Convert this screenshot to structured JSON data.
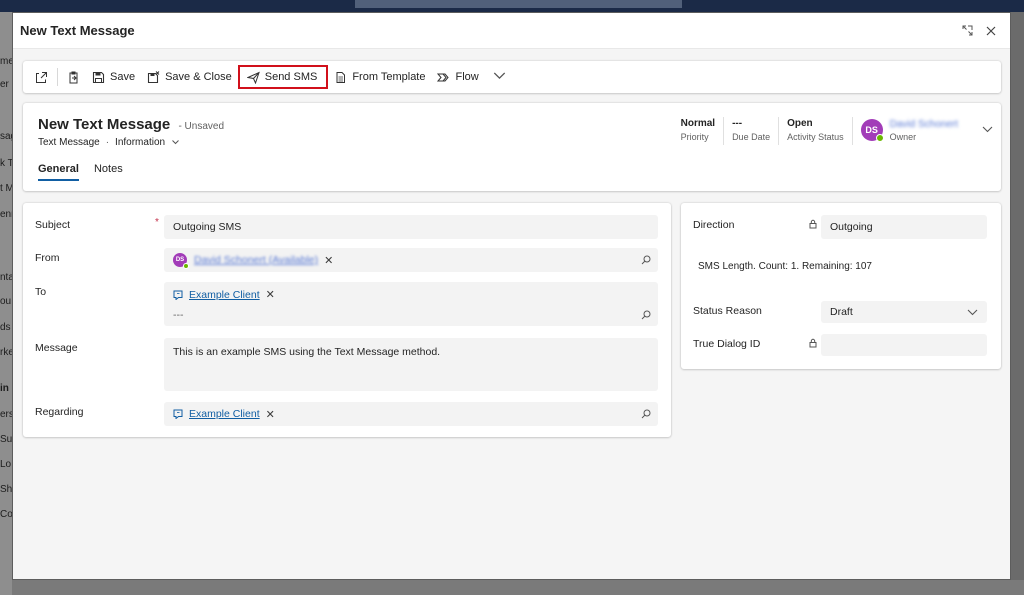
{
  "modal": {
    "title": "New Text Message"
  },
  "background": {
    "sidebar_fragments": [
      "me",
      "er",
      "sag",
      "k T",
      "t M",
      "enn",
      "nta",
      "ou",
      "ds",
      "rke",
      "in",
      "ers",
      "Su",
      "Lo",
      "Sh",
      "Co"
    ]
  },
  "toolbar": {
    "save_label": "Save",
    "save_close_label": "Save & Close",
    "send_sms_label": "Send SMS",
    "from_template_label": "From Template",
    "flow_label": "Flow"
  },
  "record": {
    "title": "New Text Message",
    "status": "- Unsaved",
    "entity": "Text Message",
    "form": "Information",
    "tabs": [
      "General",
      "Notes"
    ]
  },
  "header_fields": [
    {
      "value": "Normal",
      "label": "Priority"
    },
    {
      "value": "---",
      "label": "Due Date"
    },
    {
      "value": "Open",
      "label": "Activity Status"
    }
  ],
  "owner": {
    "initials": "DS",
    "name": "David Schonert",
    "label": "Owner"
  },
  "general": {
    "subject_label": "Subject",
    "subject_value": "Outgoing SMS",
    "from_label": "From",
    "from_value": "David Schonert (Available)",
    "from_initials": "DS",
    "to_label": "To",
    "to_value": "Example Client",
    "to_placeholder": "---",
    "message_label": "Message",
    "message_value": "This is an example SMS using the Text Message method.",
    "regarding_label": "Regarding",
    "regarding_value": "Example Client"
  },
  "details": {
    "direction_label": "Direction",
    "direction_value": "Outgoing",
    "sms_length_text": "SMS Length. Count: 1. Remaining: 107",
    "status_reason_label": "Status Reason",
    "status_reason_value": "Draft",
    "true_dialog_label": "True Dialog ID",
    "true_dialog_value": ""
  },
  "colors": {
    "accent": "#115ea3",
    "highlight_border": "#d1101b",
    "avatar": "#a23cb8",
    "presence": "#6bb700"
  }
}
